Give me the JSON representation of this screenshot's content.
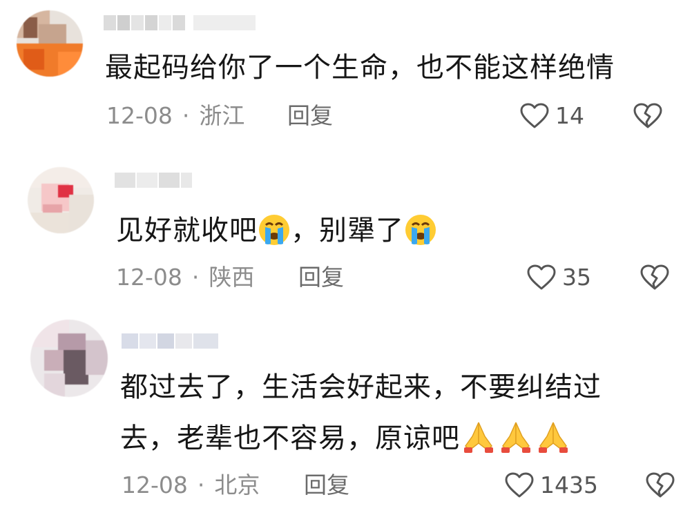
{
  "comments": [
    {
      "text": "最起码给你了一个生命，也不能这样绝情",
      "date": "12-08",
      "location": "浙江",
      "reply_label": "回复",
      "likes": "14"
    },
    {
      "text_a": "见好就收吧",
      "text_b": "，别犟了",
      "emoji": "loudly-crying-face",
      "date": "12-08",
      "location": "陕西",
      "reply_label": "回复",
      "likes": "35"
    },
    {
      "line1": "都过去了，生活会好起来，不要纠结过",
      "line2": "去，老辈也不容易，原谅吧",
      "emoji": "folded-hands",
      "date": "12-08",
      "location": "北京",
      "reply_label": "回复",
      "likes": "1435"
    }
  ],
  "separator": "·",
  "icons": {
    "like": "heart-outline-icon",
    "dislike": "broken-heart-icon"
  },
  "colors": {
    "text": "#161616",
    "meta": "#8c8c8c",
    "icon": "#555555"
  }
}
